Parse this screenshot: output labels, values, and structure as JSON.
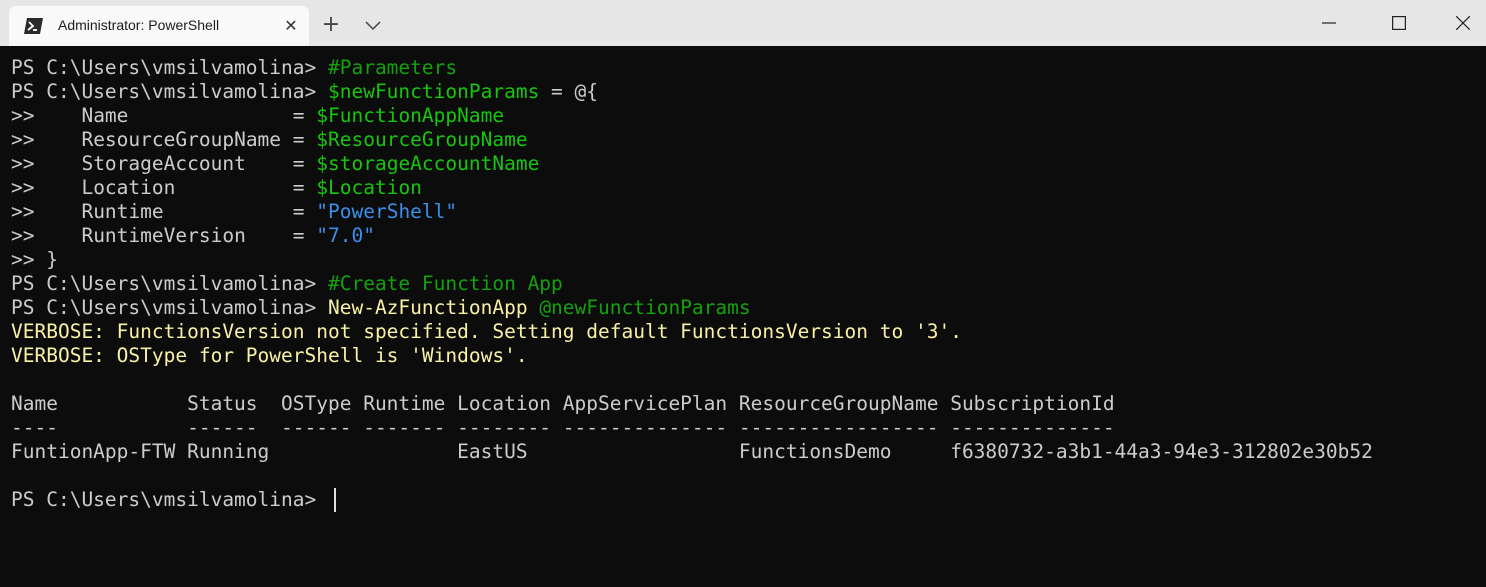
{
  "window": {
    "tab_title": "Administrator: PowerShell",
    "tab_close": "✕",
    "new_tab": "+"
  },
  "terminal": {
    "prompt": "PS C:\\Users\\vmsilvamolina> ",
    "cont": ">> ",
    "lines": {
      "l1_comment": "#Parameters",
      "l2_var": "$newFunctionParams",
      "l2_rest": " = @{",
      "l3_key": "   Name              = ",
      "l3_val": "$FunctionAppName",
      "l4_key": "   ResourceGroupName = ",
      "l4_val": "$ResourceGroupName",
      "l5_key": "   StorageAccount    = ",
      "l5_val": "$storageAccountName",
      "l6_key": "   Location          = ",
      "l6_val": "$Location",
      "l7_key": "   Runtime           = ",
      "l7_val": "\"PowerShell\"",
      "l8_key": "   RuntimeVersion    = ",
      "l8_val": "\"7.0\"",
      "l9_close": "}",
      "l10_comment": "#Create Function App",
      "l11_cmd": "New-AzFunctionApp ",
      "l11_param": "@newFunctionParams",
      "l12_verbose": "VERBOSE: FunctionsVersion not specified. Setting default FunctionsVersion to '3'.",
      "l13_verbose": "VERBOSE: OSType for PowerShell is 'Windows'."
    },
    "table": {
      "header": "Name           Status  OSType Runtime Location AppServicePlan ResourceGroupName SubscriptionId",
      "separator": "----           ------  ------ ------- -------- -------------- ----------------- --------------",
      "row": "FuntionApp-FTW Running                EastUS                  FunctionsDemo     f6380732-a3b1-44a3-94e3-312802e30b52"
    },
    "final_prompt": "PS C:\\Users\\vmsilvamolina> "
  },
  "colors": {
    "background": "#0c0c0c",
    "foreground": "#cccccc",
    "comment": "#13a10e",
    "variable": "#16c60c",
    "string": "#3b8eea",
    "command": "#f9f1a5",
    "verbose": "#f9f1a5"
  },
  "icons": [
    "powershell-icon",
    "close-icon",
    "plus-icon",
    "chevron-down-icon",
    "minimize-icon",
    "maximize-icon",
    "window-close-icon"
  ]
}
